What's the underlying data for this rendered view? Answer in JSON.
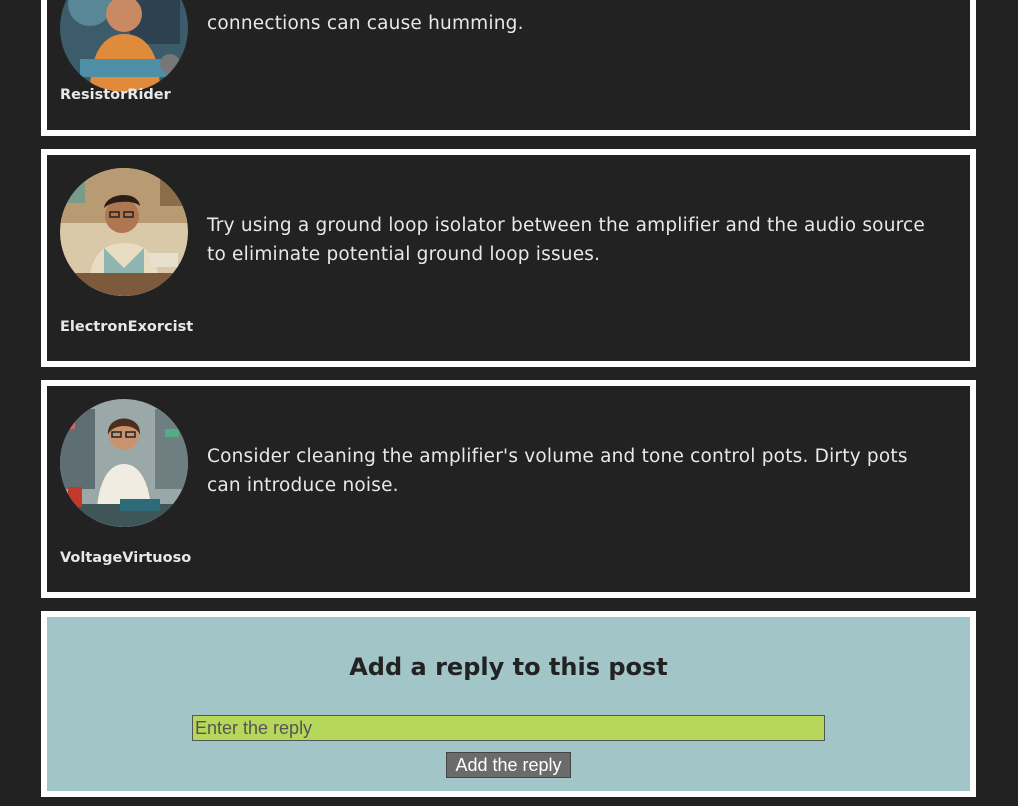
{
  "replies": [
    {
      "author": "ResistorRider",
      "text": "connections can cause humming.",
      "avatar_icon": "avatar-resistorrider-icon"
    },
    {
      "author": "ElectronExorcist",
      "text": "Try using a ground loop isolator between the amplifier and the audio source to eliminate potential ground loop issues.",
      "avatar_icon": "avatar-electronexorcist-icon"
    },
    {
      "author": "VoltageVirtuoso",
      "text": "Consider cleaning the amplifier's volume and tone control pots. Dirty pots can introduce noise.",
      "avatar_icon": "avatar-voltagevirtuoso-icon"
    }
  ],
  "reply_form": {
    "title": "Add a reply to this post",
    "placeholder": "Enter the reply",
    "submit_label": "Add the reply"
  },
  "colors": {
    "page_bg": "#222222",
    "card_border": "#ffffff",
    "form_bg": "#a2c5c7",
    "input_bg": "#b5d75a",
    "button_bg": "#6b6b6b"
  }
}
